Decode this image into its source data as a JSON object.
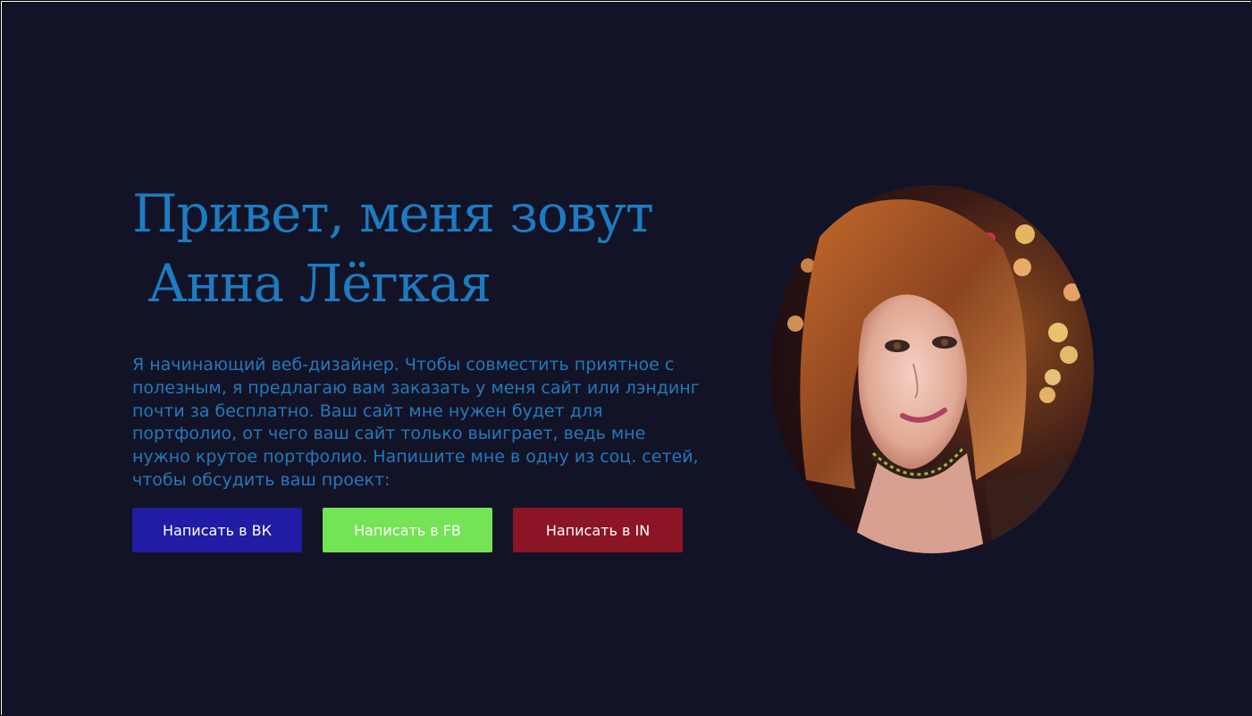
{
  "hero": {
    "heading_line1": "Привет, меня зовут",
    "heading_line2": " Анна Лёгкая",
    "intro": "Я начинающий веб-дизайнер. Чтобы совместить приятное с полезным, я предлагаю вам заказать у меня сайт или лэндинг почти за бесплатно. Ваш сайт мне нужен будет для портфолио, от чего ваш сайт только выиграет, ведь мне нужно крутое портфолио. Напишите мне в одну из соц. сетей, чтобы обсудить ваш проект:"
  },
  "buttons": [
    {
      "label": "Написать в ВК",
      "color": "#211ba5"
    },
    {
      "label": "Написать в FB",
      "color": "#74e355"
    },
    {
      "label": "Написать в IN",
      "color": "#8b1425"
    }
  ],
  "colors": {
    "background": "#131327",
    "heading": "#1c7cc1",
    "text": "#2379ba"
  }
}
